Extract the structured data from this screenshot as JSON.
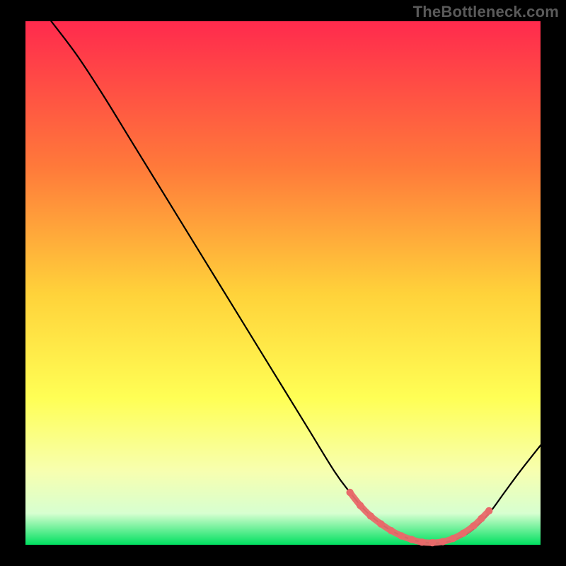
{
  "watermark": "TheBottleneck.com",
  "colors": {
    "background": "#000000",
    "gradient_top": "#ff2a4d",
    "gradient_mid1": "#ff7a3a",
    "gradient_mid2": "#ffd23a",
    "gradient_mid3": "#ffff55",
    "gradient_mid4": "#f7ffb0",
    "gradient_bottom_pale": "#d7ffd0",
    "gradient_bottom": "#00e060",
    "curve": "#000000",
    "highlight": "#e86a6a"
  },
  "chart_data": {
    "type": "line",
    "title": "",
    "xlabel": "",
    "ylabel": "",
    "xlim": [
      0,
      100
    ],
    "ylim": [
      0,
      100
    ],
    "grid": false,
    "legend": false,
    "annotations": [],
    "series": [
      {
        "name": "curve",
        "x": [
          5,
          10,
          15,
          20,
          25,
          30,
          35,
          40,
          45,
          50,
          55,
          60,
          63,
          66,
          69,
          72,
          75,
          78,
          81,
          84,
          87,
          90,
          93,
          96,
          100
        ],
        "y": [
          100,
          93.5,
          86,
          78,
          70,
          62,
          54,
          46,
          38,
          30,
          22,
          14,
          10,
          6.5,
          4,
          2.2,
          1,
          0.4,
          0.4,
          1.2,
          3,
          6,
          10,
          14,
          19
        ]
      }
    ],
    "highlight": {
      "note": "dotted salmon segment near bottom of valley",
      "points": [
        {
          "x": 63,
          "y": 10
        },
        {
          "x": 65,
          "y": 7.5
        },
        {
          "x": 67,
          "y": 5.5
        },
        {
          "x": 69,
          "y": 4
        },
        {
          "x": 71,
          "y": 2.7
        },
        {
          "x": 73,
          "y": 1.7
        },
        {
          "x": 75,
          "y": 1
        },
        {
          "x": 77,
          "y": 0.5
        },
        {
          "x": 79,
          "y": 0.4
        },
        {
          "x": 81,
          "y": 0.6
        },
        {
          "x": 83,
          "y": 1.2
        },
        {
          "x": 85,
          "y": 2.2
        },
        {
          "x": 87,
          "y": 3.6
        },
        {
          "x": 88.5,
          "y": 5
        },
        {
          "x": 90,
          "y": 6.5
        }
      ]
    }
  }
}
